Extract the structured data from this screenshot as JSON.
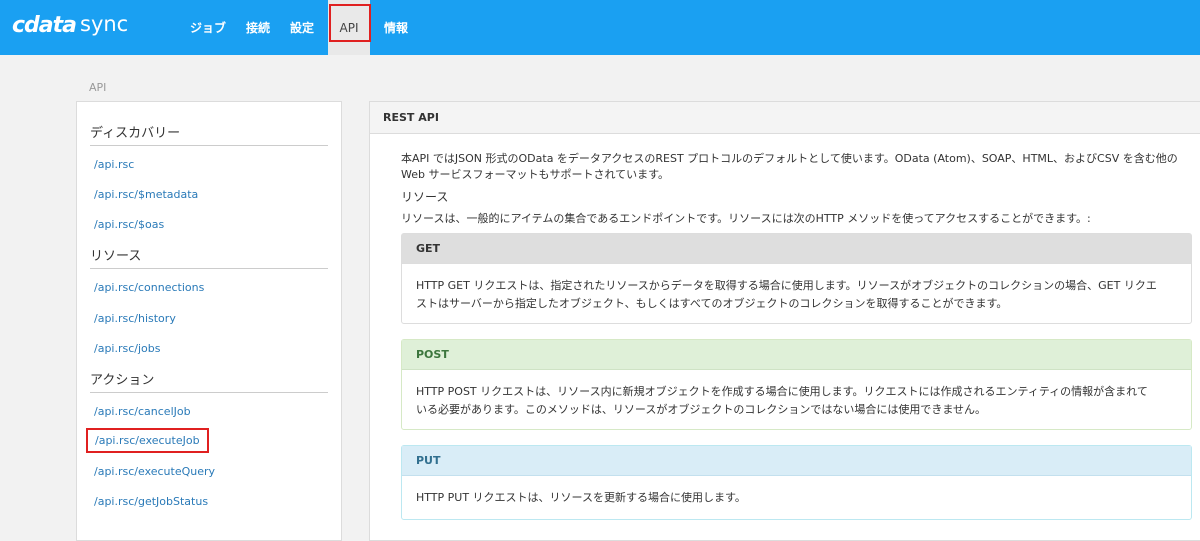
{
  "app": {
    "logo_cdata": "cdata",
    "logo_sync": "sync"
  },
  "nav": {
    "items": [
      "ジョブ",
      "接続",
      "設定",
      "API",
      "情報"
    ],
    "active": "API"
  },
  "page": {
    "section_label": "API"
  },
  "sidebar": {
    "groups": [
      {
        "heading": "ディスカバリー",
        "links": [
          "/api.rsc",
          "/api.rsc/$metadata",
          "/api.rsc/$oas"
        ]
      },
      {
        "heading": "リソース",
        "links": [
          "/api.rsc/connections",
          "/api.rsc/history",
          "/api.rsc/jobs"
        ]
      },
      {
        "heading": "アクション",
        "links": [
          "/api.rsc/cancelJob",
          "/api.rsc/executeJob",
          "/api.rsc/executeQuery",
          "/api.rsc/getJobStatus"
        ]
      }
    ],
    "highlighted_link": "/api.rsc/executeJob"
  },
  "panel": {
    "title": "REST API",
    "intro_line1": "本API ではJSON 形式のOData をデータアクセスのREST プロトコルのデフォルトとして使います。OData (Atom)、SOAP、HTML、およびCSV を含む他の",
    "intro_line2": "Web サービスフォーマットもサポートされています。",
    "resources_title": "リソース",
    "resources_desc": "リソースは、一般的にアイテムの集合であるエンドポイントです。リソースには次のHTTP メソッドを使ってアクセスすることができます。:",
    "methods": [
      {
        "name": "GET",
        "line1": "HTTP GET リクエストは、指定されたリソースからデータを取得する場合に使用します。リソースがオブジェクトのコレクションの場合、GET リクエ",
        "line2": "ストはサーバーから指定したオブジェクト、もしくはすべてのオブジェクトのコレクションを取得することができます。"
      },
      {
        "name": "POST",
        "line1": "HTTP POST リクエストは、リソース内に新規オブジェクトを作成する場合に使用します。リクエストには作成されるエンティティの情報が含まれて",
        "line2": "いる必要があります。このメソッドは、リソースがオブジェクトのコレクションではない場合には使用できません。"
      },
      {
        "name": "PUT",
        "line1": "HTTP PUT リクエストは、リソースを更新する場合に使用します。",
        "line2": ""
      }
    ]
  },
  "colors": {
    "topbar": "#1aa0f2",
    "link": "#2a7ab8",
    "highlight_border": "#e02020"
  }
}
